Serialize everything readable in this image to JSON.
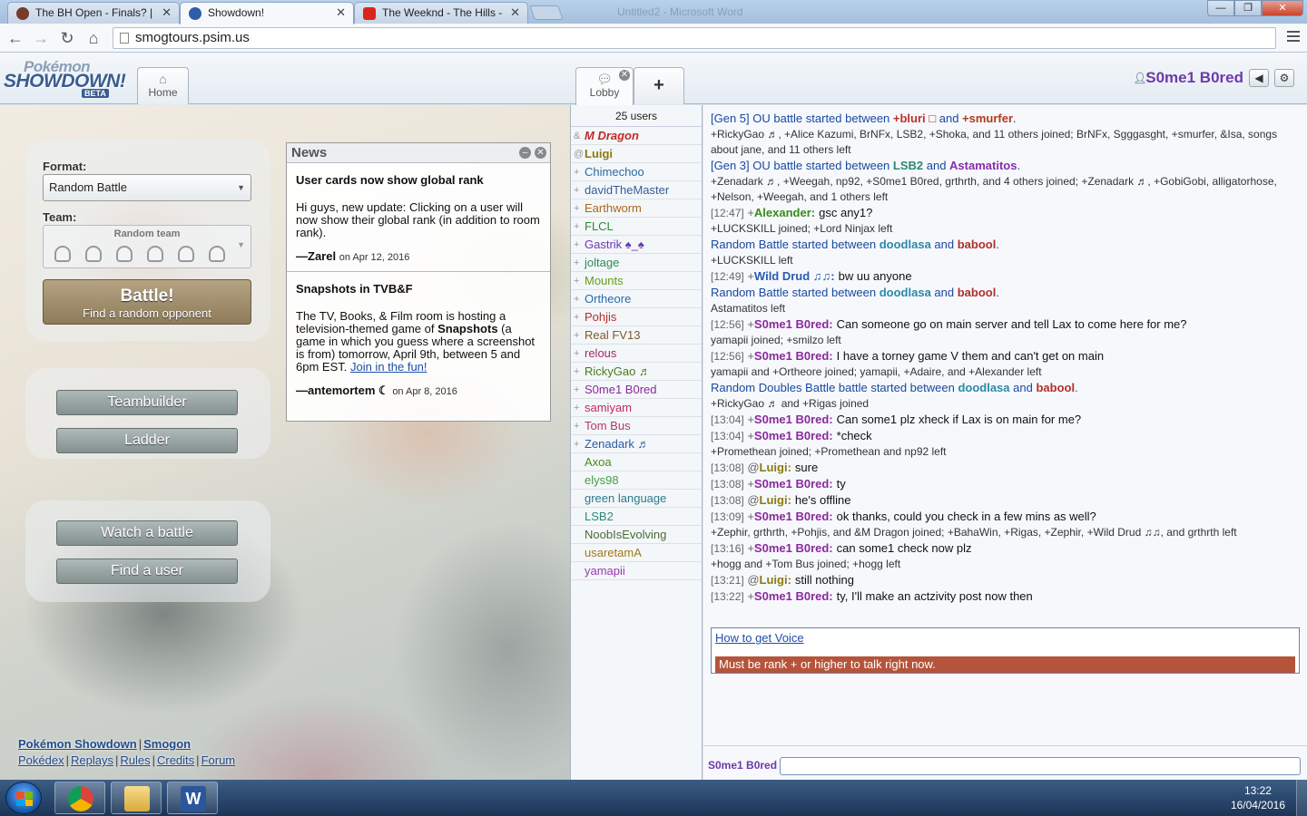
{
  "browser": {
    "tabs": [
      {
        "title": "The BH Open - Finals? | Sr",
        "favicon_color": "#7a3a2a"
      },
      {
        "title": "Showdown!",
        "favicon_color": "#2d5ea6"
      },
      {
        "title": "The Weeknd - The Hills - ‘",
        "favicon_color": "#d8261e"
      }
    ],
    "faint_title": "Untitled2 - Microsoft Word",
    "url": "smogtours.psim.us"
  },
  "header": {
    "logo_line1": "Pokémon",
    "logo_line2": "SHOWDOWN!",
    "logo_line3": "BETA",
    "home_tab": "Home",
    "lobby_tab": "Lobby",
    "username": "S0me1 B0red"
  },
  "home": {
    "format_label": "Format:",
    "format_value": "Random Battle",
    "team_label": "Team:",
    "team_value": "Random team",
    "battle_title": "Battle!",
    "battle_subtitle": "Find a random opponent",
    "buttons": {
      "teambuilder": "Teambuilder",
      "ladder": "Ladder",
      "watch": "Watch a battle",
      "find": "Find a user"
    },
    "footer": {
      "row1": [
        "Pokémon Showdown",
        "Smogon"
      ],
      "row2": [
        "Pokédex",
        "Replays",
        "Rules",
        "Credits",
        "Forum"
      ]
    }
  },
  "news": {
    "title": "News",
    "items": [
      {
        "headline": "User cards now show global rank",
        "body": "Hi guys, new update: Clicking on a user will now show their global rank (in addition to room rank).",
        "author": "—Zarel",
        "date": "on Apr 12, 2016"
      },
      {
        "headline": "Snapshots in TVB&F",
        "body_pre": "The TV, Books, & Film room is hosting a television-themed game of ",
        "body_bold": "Snapshots",
        "body_post": " (a game in which you guess where a screenshot is from) tomorrow, April 9th, between 5 and 6pm EST. ",
        "link": "Join in the fun!",
        "author": "—antemortem ☾",
        "date": "on Apr 8, 2016"
      }
    ]
  },
  "userlist": {
    "count": "25 users",
    "users": [
      {
        "rank": "&",
        "name": "M Dragon",
        "color": "#c02a2a",
        "style": "bi"
      },
      {
        "rank": "@",
        "name": "Luigi",
        "color": "#8a7a10",
        "style": "b"
      },
      {
        "rank": "+",
        "name": "Chimechoo",
        "color": "#2a6aa8"
      },
      {
        "rank": "+",
        "name": "davidTheMaster",
        "color": "#3a5a9a"
      },
      {
        "rank": "+",
        "name": "Earthworm",
        "color": "#b0661a"
      },
      {
        "rank": "+",
        "name": "FLCL",
        "color": "#2a8a3a"
      },
      {
        "rank": "+",
        "name": "Gastrik ♠_♠",
        "color": "#6a3ab0"
      },
      {
        "rank": "+",
        "name": "joltage",
        "color": "#2a8a5a"
      },
      {
        "rank": "+",
        "name": "Mounts",
        "color": "#6a9a1a"
      },
      {
        "rank": "+",
        "name": "Ortheore",
        "color": "#2a6aa8"
      },
      {
        "rank": "+",
        "name": "Pohjis",
        "color": "#b0302a"
      },
      {
        "rank": "+",
        "name": "Real FV13",
        "color": "#7a5a2a"
      },
      {
        "rank": "+",
        "name": "relous",
        "color": "#a02a6a"
      },
      {
        "rank": "+",
        "name": "RickyGao ♬",
        "color": "#4a7a1a"
      },
      {
        "rank": "+",
        "name": "S0me1 B0red",
        "color": "#8a2a9a"
      },
      {
        "rank": "+",
        "name": "samiyam",
        "color": "#c02a5a"
      },
      {
        "rank": "+",
        "name": "Tom Bus",
        "color": "#b03a6a"
      },
      {
        "rank": "+",
        "name": "Zenadark ♬",
        "color": "#2a5aa8"
      },
      {
        "rank": "",
        "name": "Axoa",
        "color": "#4a8a1a"
      },
      {
        "rank": "",
        "name": "elys98",
        "color": "#4a9a4a"
      },
      {
        "rank": "",
        "name": "green language",
        "color": "#2a7a8a"
      },
      {
        "rank": "",
        "name": "LSB2",
        "color": "#2a8a7a"
      },
      {
        "rank": "",
        "name": "NoobIsEvolving",
        "color": "#4a6a3a"
      },
      {
        "rank": "",
        "name": "usaretamA",
        "color": "#a07a1a"
      },
      {
        "rank": "",
        "name": "yamapii",
        "color": "#9a3ab0"
      }
    ]
  },
  "chat": {
    "lines": [
      {
        "kind": "battle",
        "parts": [
          [
            "[Gen 5] OU battle started between ",
            ""
          ],
          [
            "+bluri □",
            "#c0302a"
          ],
          [
            " and ",
            ""
          ],
          [
            "+smurfer",
            "#b03a1a"
          ],
          [
            ".",
            ""
          ]
        ]
      },
      {
        "kind": "sys",
        "text": "+RickyGao ♬, +Alice Kazumi, BrNFx, LSB2, +Shoka, and 11 others joined; BrNFx, Sgggasght, +smurfer, &Isa, songs about jane, and 11 others left"
      },
      {
        "kind": "battle",
        "parts": [
          [
            "[Gen 3] OU battle started between ",
            ""
          ],
          [
            "LSB2",
            "#2a8a7a"
          ],
          [
            " and ",
            ""
          ],
          [
            "Astamatitos",
            "#8a2ab0"
          ],
          [
            ".",
            ""
          ]
        ]
      },
      {
        "kind": "sys",
        "text": "+Zenadark ♬, +Weegah, np92, +S0me1 B0red, grthrth, and 4 others joined; +Zenadark ♬, +GobiGobi, alligatorhose, +Nelson, +Weegah, and 1 others left"
      },
      {
        "kind": "msg",
        "ts": "[12:47]",
        "rank": "+",
        "name": "Alexander:",
        "color": "#3a8a1a",
        "text": "gsc any1?"
      },
      {
        "kind": "sys",
        "text": "+LUCKSKILL joined; +Lord Ninjax left"
      },
      {
        "kind": "battle",
        "parts": [
          [
            "Random Battle started between ",
            ""
          ],
          [
            "doodlasa",
            "#2a8aa8"
          ],
          [
            " and ",
            ""
          ],
          [
            "babool",
            "#b0302a"
          ],
          [
            ".",
            ""
          ]
        ]
      },
      {
        "kind": "sys",
        "text": "+LUCKSKILL left"
      },
      {
        "kind": "msg",
        "ts": "[12:49]",
        "rank": "+",
        "name": "Wild Drud ♫♫:",
        "color": "#2a5ab0",
        "text": "bw uu anyone"
      },
      {
        "kind": "battle",
        "parts": [
          [
            "Random Battle started between ",
            ""
          ],
          [
            "doodlasa",
            "#2a8aa8"
          ],
          [
            " and ",
            ""
          ],
          [
            "babool",
            "#b0302a"
          ],
          [
            ".",
            ""
          ]
        ]
      },
      {
        "kind": "sys",
        "text": "Astamatitos left"
      },
      {
        "kind": "msg",
        "ts": "[12:56]",
        "rank": "+",
        "name": "S0me1 B0red:",
        "color": "#8a2a9a",
        "text": "Can someone go on main server and tell Lax to come here for me?"
      },
      {
        "kind": "sys",
        "text": "yamapii joined; +smilzo left"
      },
      {
        "kind": "msg",
        "ts": "[12:56]",
        "rank": "+",
        "name": "S0me1 B0red:",
        "color": "#8a2a9a",
        "text": "I have a torney game V them and can't get on main"
      },
      {
        "kind": "sys",
        "text": "yamapii and +Ortheore joined; yamapii, +Adaire, and +Alexander left"
      },
      {
        "kind": "battle",
        "parts": [
          [
            "Random Doubles Battle battle started between ",
            ""
          ],
          [
            "doodlasa",
            "#2a8aa8"
          ],
          [
            " and ",
            ""
          ],
          [
            "babool",
            "#b0302a"
          ],
          [
            ".",
            ""
          ]
        ]
      },
      {
        "kind": "sys",
        "text": "+RickyGao ♬ and +Rigas joined"
      },
      {
        "kind": "msg",
        "ts": "[13:04]",
        "rank": "+",
        "name": "S0me1 B0red:",
        "color": "#8a2a9a",
        "text": "Can some1 plz xheck if Lax is on main for me?"
      },
      {
        "kind": "msg",
        "ts": "[13:04]",
        "rank": "+",
        "name": "S0me1 B0red:",
        "color": "#8a2a9a",
        "text": "*check"
      },
      {
        "kind": "sys",
        "text": "+Promethean joined; +Promethean and np92 left"
      },
      {
        "kind": "msg",
        "ts": "[13:08]",
        "rank": "@",
        "name": "Luigi:",
        "color": "#8a7a10",
        "text": "sure"
      },
      {
        "kind": "msg",
        "ts": "[13:08]",
        "rank": "+",
        "name": "S0me1 B0red:",
        "color": "#8a2a9a",
        "text": "ty"
      },
      {
        "kind": "msg",
        "ts": "[13:08]",
        "rank": "@",
        "name": "Luigi:",
        "color": "#8a7a10",
        "text": "he's offline"
      },
      {
        "kind": "msg",
        "ts": "[13:09]",
        "rank": "+",
        "name": "S0me1 B0red:",
        "color": "#8a2a9a",
        "text": "ok thanks, could you check in a few mins as well?"
      },
      {
        "kind": "sys",
        "text": "+Zephir, grthrth, +Pohjis, and &M Dragon joined; +BahaWin, +Rigas, +Zephir, +Wild Drud ♫♫, and grthrth left"
      },
      {
        "kind": "msg",
        "ts": "[13:16]",
        "rank": "+",
        "name": "S0me1 B0red:",
        "color": "#8a2a9a",
        "text": "can some1 check now plz"
      },
      {
        "kind": "sys",
        "text": "+hogg and +Tom Bus joined; +hogg left"
      },
      {
        "kind": "msg",
        "ts": "[13:21]",
        "rank": "@",
        "name": "Luigi:",
        "color": "#8a7a10",
        "text": "still nothing"
      },
      {
        "kind": "msg",
        "ts": "[13:22]",
        "rank": "+",
        "name": "S0me1 B0red:",
        "color": "#8a2a9a",
        "text": "ty, I'll make an actzivity post now then"
      }
    ],
    "voice_link": "How to get Voice",
    "voice_error": "Must be rank + or higher to talk right now.",
    "input_name": "S0me1 B0red"
  },
  "taskbar": {
    "time": "13:22",
    "date": "16/04/2016"
  }
}
